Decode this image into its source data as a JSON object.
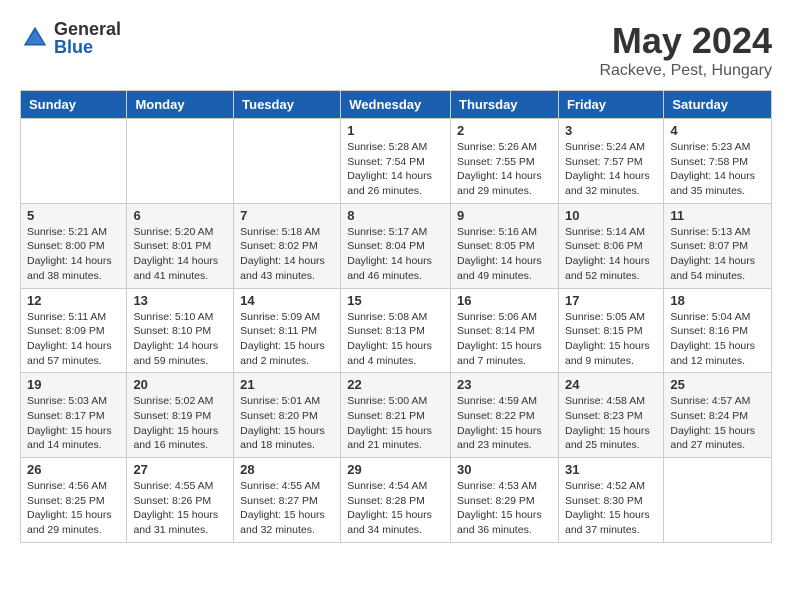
{
  "header": {
    "logo_general": "General",
    "logo_blue": "Blue",
    "month_year": "May 2024",
    "location": "Rackeve, Pest, Hungary"
  },
  "weekdays": [
    "Sunday",
    "Monday",
    "Tuesday",
    "Wednesday",
    "Thursday",
    "Friday",
    "Saturday"
  ],
  "weeks": [
    [
      {
        "day": "",
        "content": ""
      },
      {
        "day": "",
        "content": ""
      },
      {
        "day": "",
        "content": ""
      },
      {
        "day": "1",
        "content": "Sunrise: 5:28 AM\nSunset: 7:54 PM\nDaylight: 14 hours and 26 minutes."
      },
      {
        "day": "2",
        "content": "Sunrise: 5:26 AM\nSunset: 7:55 PM\nDaylight: 14 hours and 29 minutes."
      },
      {
        "day": "3",
        "content": "Sunrise: 5:24 AM\nSunset: 7:57 PM\nDaylight: 14 hours and 32 minutes."
      },
      {
        "day": "4",
        "content": "Sunrise: 5:23 AM\nSunset: 7:58 PM\nDaylight: 14 hours and 35 minutes."
      }
    ],
    [
      {
        "day": "5",
        "content": "Sunrise: 5:21 AM\nSunset: 8:00 PM\nDaylight: 14 hours and 38 minutes."
      },
      {
        "day": "6",
        "content": "Sunrise: 5:20 AM\nSunset: 8:01 PM\nDaylight: 14 hours and 41 minutes."
      },
      {
        "day": "7",
        "content": "Sunrise: 5:18 AM\nSunset: 8:02 PM\nDaylight: 14 hours and 43 minutes."
      },
      {
        "day": "8",
        "content": "Sunrise: 5:17 AM\nSunset: 8:04 PM\nDaylight: 14 hours and 46 minutes."
      },
      {
        "day": "9",
        "content": "Sunrise: 5:16 AM\nSunset: 8:05 PM\nDaylight: 14 hours and 49 minutes."
      },
      {
        "day": "10",
        "content": "Sunrise: 5:14 AM\nSunset: 8:06 PM\nDaylight: 14 hours and 52 minutes."
      },
      {
        "day": "11",
        "content": "Sunrise: 5:13 AM\nSunset: 8:07 PM\nDaylight: 14 hours and 54 minutes."
      }
    ],
    [
      {
        "day": "12",
        "content": "Sunrise: 5:11 AM\nSunset: 8:09 PM\nDaylight: 14 hours and 57 minutes."
      },
      {
        "day": "13",
        "content": "Sunrise: 5:10 AM\nSunset: 8:10 PM\nDaylight: 14 hours and 59 minutes."
      },
      {
        "day": "14",
        "content": "Sunrise: 5:09 AM\nSunset: 8:11 PM\nDaylight: 15 hours and 2 minutes."
      },
      {
        "day": "15",
        "content": "Sunrise: 5:08 AM\nSunset: 8:13 PM\nDaylight: 15 hours and 4 minutes."
      },
      {
        "day": "16",
        "content": "Sunrise: 5:06 AM\nSunset: 8:14 PM\nDaylight: 15 hours and 7 minutes."
      },
      {
        "day": "17",
        "content": "Sunrise: 5:05 AM\nSunset: 8:15 PM\nDaylight: 15 hours and 9 minutes."
      },
      {
        "day": "18",
        "content": "Sunrise: 5:04 AM\nSunset: 8:16 PM\nDaylight: 15 hours and 12 minutes."
      }
    ],
    [
      {
        "day": "19",
        "content": "Sunrise: 5:03 AM\nSunset: 8:17 PM\nDaylight: 15 hours and 14 minutes."
      },
      {
        "day": "20",
        "content": "Sunrise: 5:02 AM\nSunset: 8:19 PM\nDaylight: 15 hours and 16 minutes."
      },
      {
        "day": "21",
        "content": "Sunrise: 5:01 AM\nSunset: 8:20 PM\nDaylight: 15 hours and 18 minutes."
      },
      {
        "day": "22",
        "content": "Sunrise: 5:00 AM\nSunset: 8:21 PM\nDaylight: 15 hours and 21 minutes."
      },
      {
        "day": "23",
        "content": "Sunrise: 4:59 AM\nSunset: 8:22 PM\nDaylight: 15 hours and 23 minutes."
      },
      {
        "day": "24",
        "content": "Sunrise: 4:58 AM\nSunset: 8:23 PM\nDaylight: 15 hours and 25 minutes."
      },
      {
        "day": "25",
        "content": "Sunrise: 4:57 AM\nSunset: 8:24 PM\nDaylight: 15 hours and 27 minutes."
      }
    ],
    [
      {
        "day": "26",
        "content": "Sunrise: 4:56 AM\nSunset: 8:25 PM\nDaylight: 15 hours and 29 minutes."
      },
      {
        "day": "27",
        "content": "Sunrise: 4:55 AM\nSunset: 8:26 PM\nDaylight: 15 hours and 31 minutes."
      },
      {
        "day": "28",
        "content": "Sunrise: 4:55 AM\nSunset: 8:27 PM\nDaylight: 15 hours and 32 minutes."
      },
      {
        "day": "29",
        "content": "Sunrise: 4:54 AM\nSunset: 8:28 PM\nDaylight: 15 hours and 34 minutes."
      },
      {
        "day": "30",
        "content": "Sunrise: 4:53 AM\nSunset: 8:29 PM\nDaylight: 15 hours and 36 minutes."
      },
      {
        "day": "31",
        "content": "Sunrise: 4:52 AM\nSunset: 8:30 PM\nDaylight: 15 hours and 37 minutes."
      },
      {
        "day": "",
        "content": ""
      }
    ]
  ]
}
